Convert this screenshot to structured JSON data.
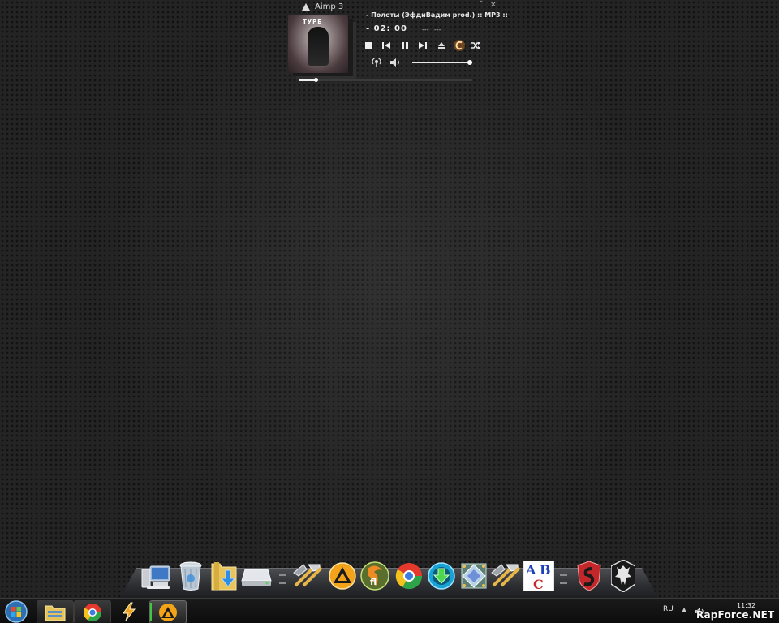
{
  "aimp": {
    "title": "Aimp 3",
    "minimize": "ˇ",
    "close": "×",
    "track": "- Полеты (ЭфдиВадим prod.) :: MP3 ::",
    "time": "- 02: 00",
    "kbps": "---",
    "khz": "---",
    "cover_text": "ТУРБ",
    "volume_level": 0.96,
    "seek_position": 0.1,
    "accent_color": "#ff8c1a"
  },
  "dock": {
    "items": [
      {
        "name": "computer",
        "icon": "computer-icon"
      },
      {
        "name": "recycle-bin",
        "icon": "recycle-bin-icon"
      },
      {
        "name": "downloads",
        "icon": "downloads-folder-icon"
      },
      {
        "name": "drive",
        "icon": "drive-icon"
      },
      {
        "name": "separator"
      },
      {
        "name": "tools",
        "icon": "hammer-icon"
      },
      {
        "name": "aimp",
        "icon": "aimp-icon"
      },
      {
        "name": "fl-studio",
        "icon": "fl-studio-icon"
      },
      {
        "name": "chrome",
        "icon": "chrome-icon"
      },
      {
        "name": "download-manager",
        "icon": "download-manager-icon"
      },
      {
        "name": "crystal-app",
        "icon": "crystal-icon"
      },
      {
        "name": "tools-2",
        "icon": "hammer-icon"
      },
      {
        "name": "abc",
        "icon": "abc-icon",
        "letters": [
          "A",
          "B",
          "C"
        ]
      },
      {
        "name": "separator"
      },
      {
        "name": "shield-app",
        "icon": "shield-icon"
      },
      {
        "name": "skyrim",
        "icon": "skyrim-icon"
      }
    ]
  },
  "taskbar": {
    "items": [
      {
        "name": "explorer",
        "icon": "folder-icon"
      },
      {
        "name": "chrome",
        "icon": "chrome-icon"
      },
      {
        "name": "winamp",
        "icon": "lightning-icon"
      },
      {
        "name": "aimp",
        "icon": "aimp-icon"
      }
    ],
    "tray": {
      "language": "RU",
      "show_hidden": "▲",
      "clock": "11:32"
    }
  },
  "watermark": "RapForce.NET"
}
